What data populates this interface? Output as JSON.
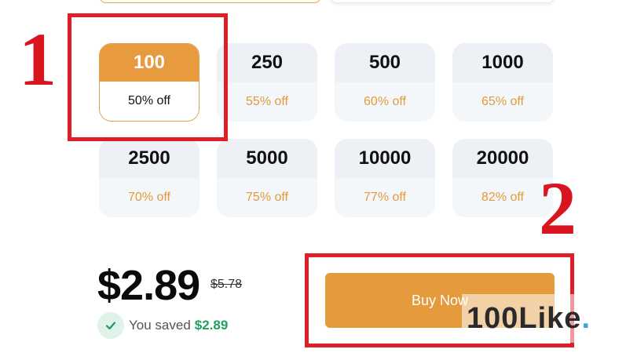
{
  "packages": [
    {
      "qty": "100",
      "off": "50% off"
    },
    {
      "qty": "250",
      "off": "55% off"
    },
    {
      "qty": "500",
      "off": "60% off"
    },
    {
      "qty": "1000",
      "off": "65% off"
    },
    {
      "qty": "2500",
      "off": "70% off"
    },
    {
      "qty": "5000",
      "off": "75% off"
    },
    {
      "qty": "10000",
      "off": "77% off"
    },
    {
      "qty": "20000",
      "off": "82% off"
    }
  ],
  "selected_package": "100",
  "annotations": {
    "step1": "1",
    "step2": "2"
  },
  "pricing": {
    "price": "$2.89",
    "old_price": "$5.78",
    "saved_label": "You saved",
    "saved_amount": "$2.89"
  },
  "buy_button": {
    "label": "Buy Now"
  },
  "watermark": {
    "text": "100Like",
    "dot": "."
  },
  "colors": {
    "accent": "#e59a3c",
    "annotation": "#e01e26",
    "saved": "#20a060"
  },
  "icons": {
    "saved": "check-icon"
  }
}
